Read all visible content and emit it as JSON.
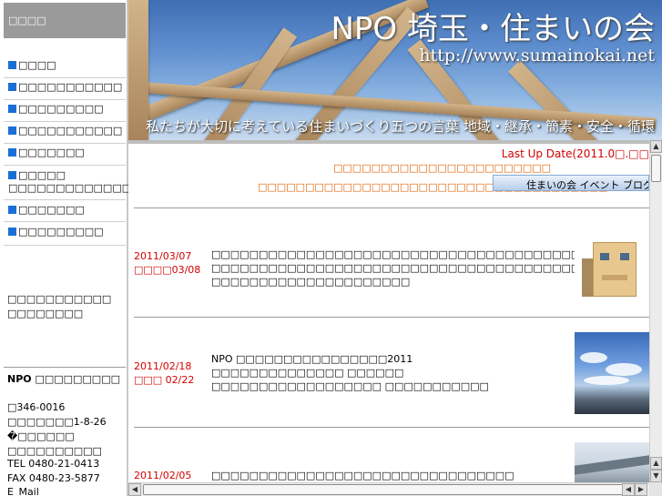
{
  "sidebar": {
    "header": "□□□□",
    "items": [
      {
        "label": "□□□□"
      },
      {
        "label": "□□□□□□□□□□□"
      },
      {
        "label": "□□□□□□□□□"
      },
      {
        "label": "□□□□□□□□□□□"
      },
      {
        "label": "□□□□□□□"
      },
      {
        "label": "□□□□□",
        "label2": "□□□□□□□□□□□□□"
      },
      {
        "label": "□□□□□□□"
      },
      {
        "label": "□□□□□□□□□"
      }
    ],
    "promo_line1": "□□□□□□□□□□□",
    "promo_line2": "□□□□□□□□",
    "org_name": "NPO □□□□□□□□□",
    "postal": "□346-0016",
    "address1": "□□□□□□□1-8-26",
    "address2": "�□□□□□□",
    "address3": "□□□□□□□□□□",
    "tel": "TEL 0480-21-0413",
    "fax": "FAX 0480-23-5877",
    "email_label": "E_Mail"
  },
  "banner": {
    "title": "NPO 埼玉・住まいの会",
    "url": "http://www.sumainokai.net",
    "tagline": "私たちが大切に考えている住まいづくり五つの言葉  地域・継承・簡素・安全・循環"
  },
  "main": {
    "last_update": "Last Up Date(2011.0□.□□",
    "notice1": "□□□□□□□□□□□□□□□□□□□□□□□",
    "notice2": "□□□□□□□□□□□□□□□□□□□□□□□□□□□□□□□□□□□□□⇒",
    "blog_button": "住まいの会 イベント ブログ",
    "news": [
      {
        "date": "2011/03/07",
        "date2": "□□□□03/08",
        "lines": [
          "□□□□□□□□□□□□□□□□□□□□□□□□□□□□□□□□□□□□□□□□□□",
          "□□□□□□□□□□□□□□□□□□□□□□□□□□□□□□□□□□□□□□□□□□□□□□□□□□□□□□□□□□□□□□□",
          "□□□□□□□□□□□□□□□□□□□□□"
        ],
        "thumb": "house-photo"
      },
      {
        "date": "2011/02/18",
        "date2": "□□□ 02/22",
        "lines": [
          "NPO □□□□□□□□□□□□□□□□2011",
          "□□□□□□□□□□□□□□ □□□□□□",
          "□□□□□□□□□□□□□□□□□□ □□□□□□□□□□□"
        ],
        "thumb": "sky-photo"
      },
      {
        "date": "2011/02/05",
        "lines": [
          "□□□□□□□□□□□□□□□□□□□□□□□□□□□□□□□□"
        ],
        "thumb": "building-photo"
      }
    ]
  }
}
